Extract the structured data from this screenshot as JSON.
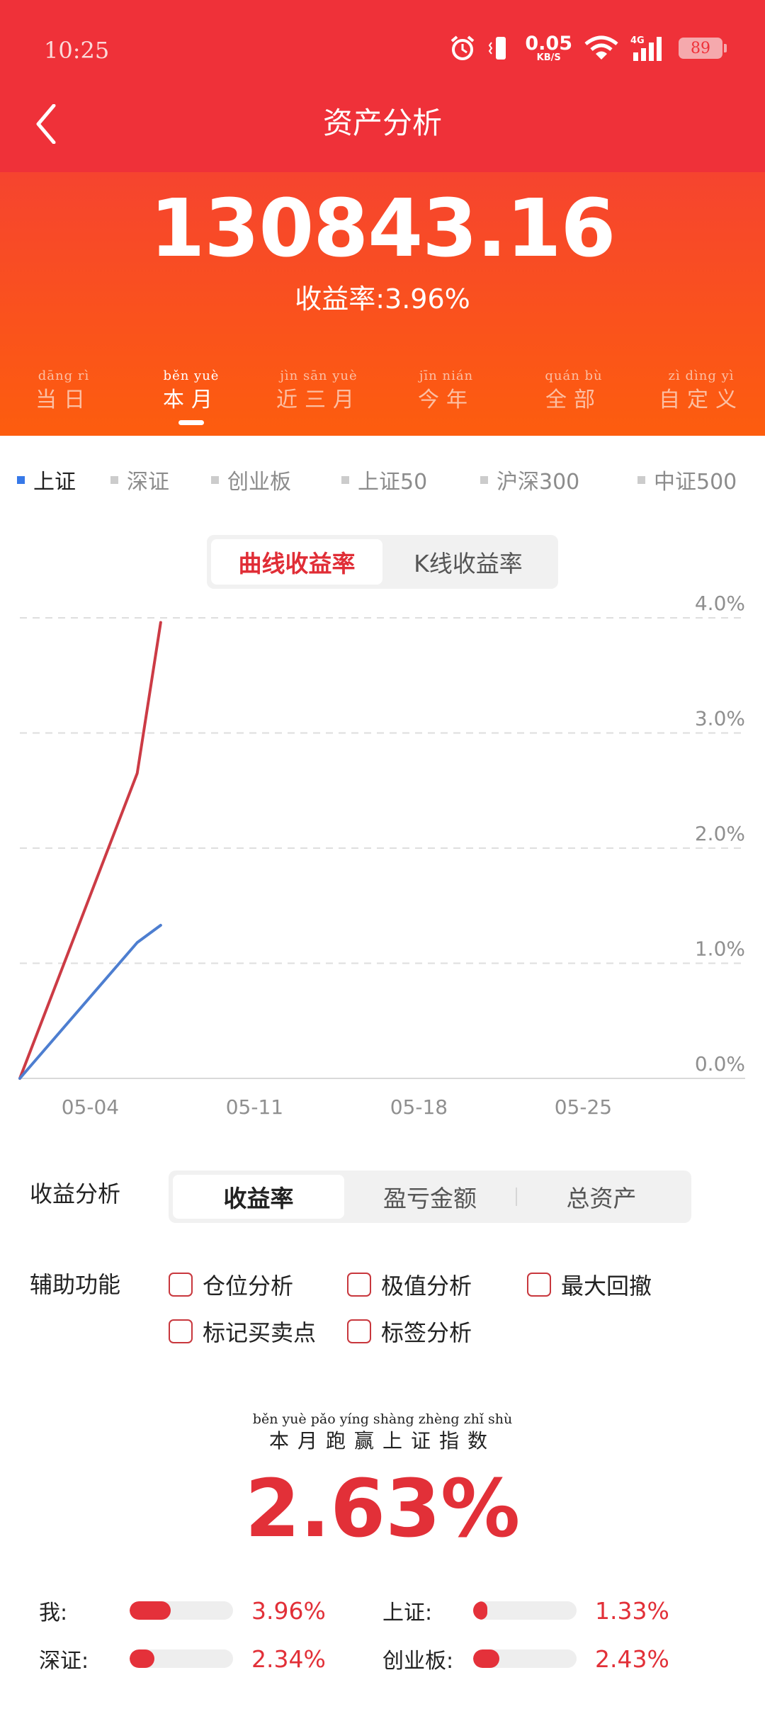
{
  "status_bar": {
    "time": "10:25",
    "speed_value": "0.05",
    "speed_unit": "KB/S",
    "network": "4G",
    "battery": "89"
  },
  "nav": {
    "title": "资产分析",
    "back_icon": "chevron-left-icon"
  },
  "summary": {
    "total": "130843.16",
    "return_rate": "收益率:3.96%"
  },
  "periods": [
    {
      "pinyin": "dāng rì",
      "label": "当日",
      "active": false
    },
    {
      "pinyin": "běn yuè",
      "label": "本月",
      "active": true
    },
    {
      "pinyin": "jìn sān yuè",
      "label": "近三月",
      "active": false
    },
    {
      "pinyin": "jīn nián",
      "label": "今年",
      "active": false
    },
    {
      "pinyin": "quán bù",
      "label": "全部",
      "active": false
    },
    {
      "pinyin": "zì dìng yì",
      "label": "自定义",
      "active": false
    }
  ],
  "index_tabs": [
    {
      "label": "上证",
      "active": true
    },
    {
      "label": "深证",
      "active": false
    },
    {
      "label": "创业板",
      "active": false
    },
    {
      "label": "上证50",
      "active": false
    },
    {
      "label": "沪深300",
      "active": false
    },
    {
      "label": "中证500",
      "active": false
    }
  ],
  "chart_mode": {
    "options": [
      "曲线收益率",
      "K线收益率"
    ],
    "active": 0
  },
  "chart_data": {
    "type": "line",
    "x_ticks": [
      "05-04",
      "05-11",
      "05-18",
      "05-25"
    ],
    "y_ticks": [
      "0.0%",
      "1.0%",
      "2.0%",
      "3.0%",
      "4.0%"
    ],
    "ylim": [
      0,
      4
    ],
    "grid": true,
    "series": [
      {
        "color": "#cc3b45",
        "points": [
          [
            "05-01",
            0
          ],
          [
            "05-06",
            2.65
          ],
          [
            "05-07",
            3.96
          ]
        ]
      },
      {
        "color": "#4d7ed0",
        "points": [
          [
            "05-01",
            0
          ],
          [
            "05-06",
            1.18
          ],
          [
            "05-07",
            1.33
          ]
        ]
      }
    ]
  },
  "income_analysis": {
    "label": "收益分析",
    "options": [
      "收益率",
      "盈亏金额",
      "总资产"
    ],
    "active": 0
  },
  "aux": {
    "label": "辅助功能",
    "options": [
      "仓位分析",
      "极值分析",
      "最大回撤",
      "标记买卖点",
      "标签分析"
    ]
  },
  "beat": {
    "pinyin": "běn yuè pǎo yíng shàng zhèng zhǐ shù",
    "label": "本月跑赢上证指数",
    "value": "2.63%"
  },
  "comparisons": [
    {
      "label": "我:",
      "value": "3.96%",
      "ratio": 0.4
    },
    {
      "label": "上证:",
      "value": "1.33%",
      "ratio": 0.14
    },
    {
      "label": "深证:",
      "value": "2.34%",
      "ratio": 0.24
    },
    {
      "label": "创业板:",
      "value": "2.43%",
      "ratio": 0.25
    }
  ]
}
